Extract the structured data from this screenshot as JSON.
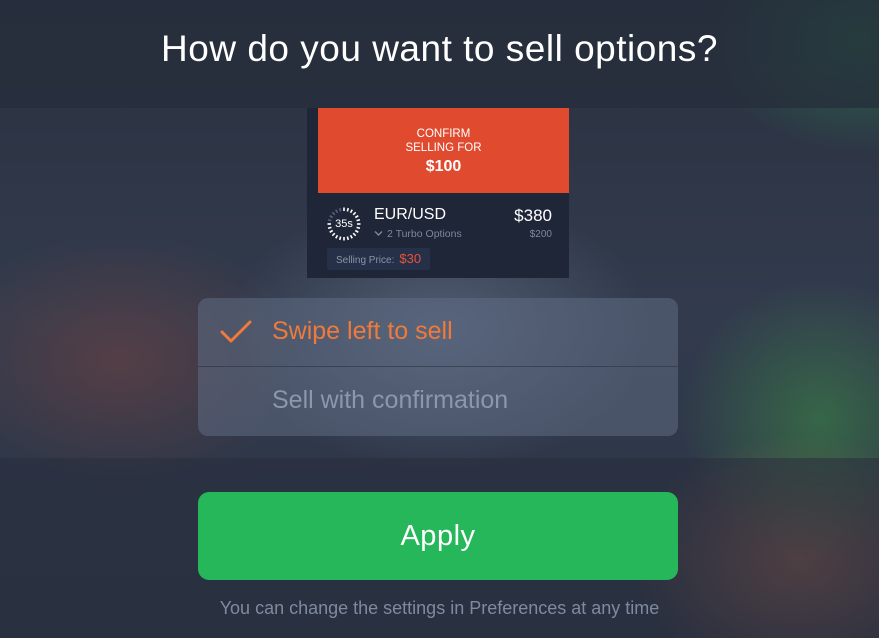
{
  "dialog": {
    "title": "How do you want to sell options?"
  },
  "preview": {
    "confirm_line1": "CONFIRM",
    "confirm_line2": "SELLING FOR",
    "confirm_amount": "$100",
    "timer": "35s",
    "pair": "EUR/USD",
    "turbo": "2 Turbo Options",
    "value_main": "$380",
    "value_sub": "$200",
    "selling_price_label": "Selling Price:",
    "selling_price_value": "$30"
  },
  "options": [
    {
      "label": "Swipe left to sell",
      "selected": true
    },
    {
      "label": "Sell with confirmation",
      "selected": false
    }
  ],
  "apply_label": "Apply",
  "footer": "You can change the settings in Preferences at any time",
  "colors": {
    "accent_orange": "#f07a3a",
    "confirm_red": "#e04b30",
    "apply_green": "#25b75a"
  },
  "icons": {
    "check": "check-icon",
    "chevron": "chevron-down-icon",
    "timer": "timer-icon"
  }
}
